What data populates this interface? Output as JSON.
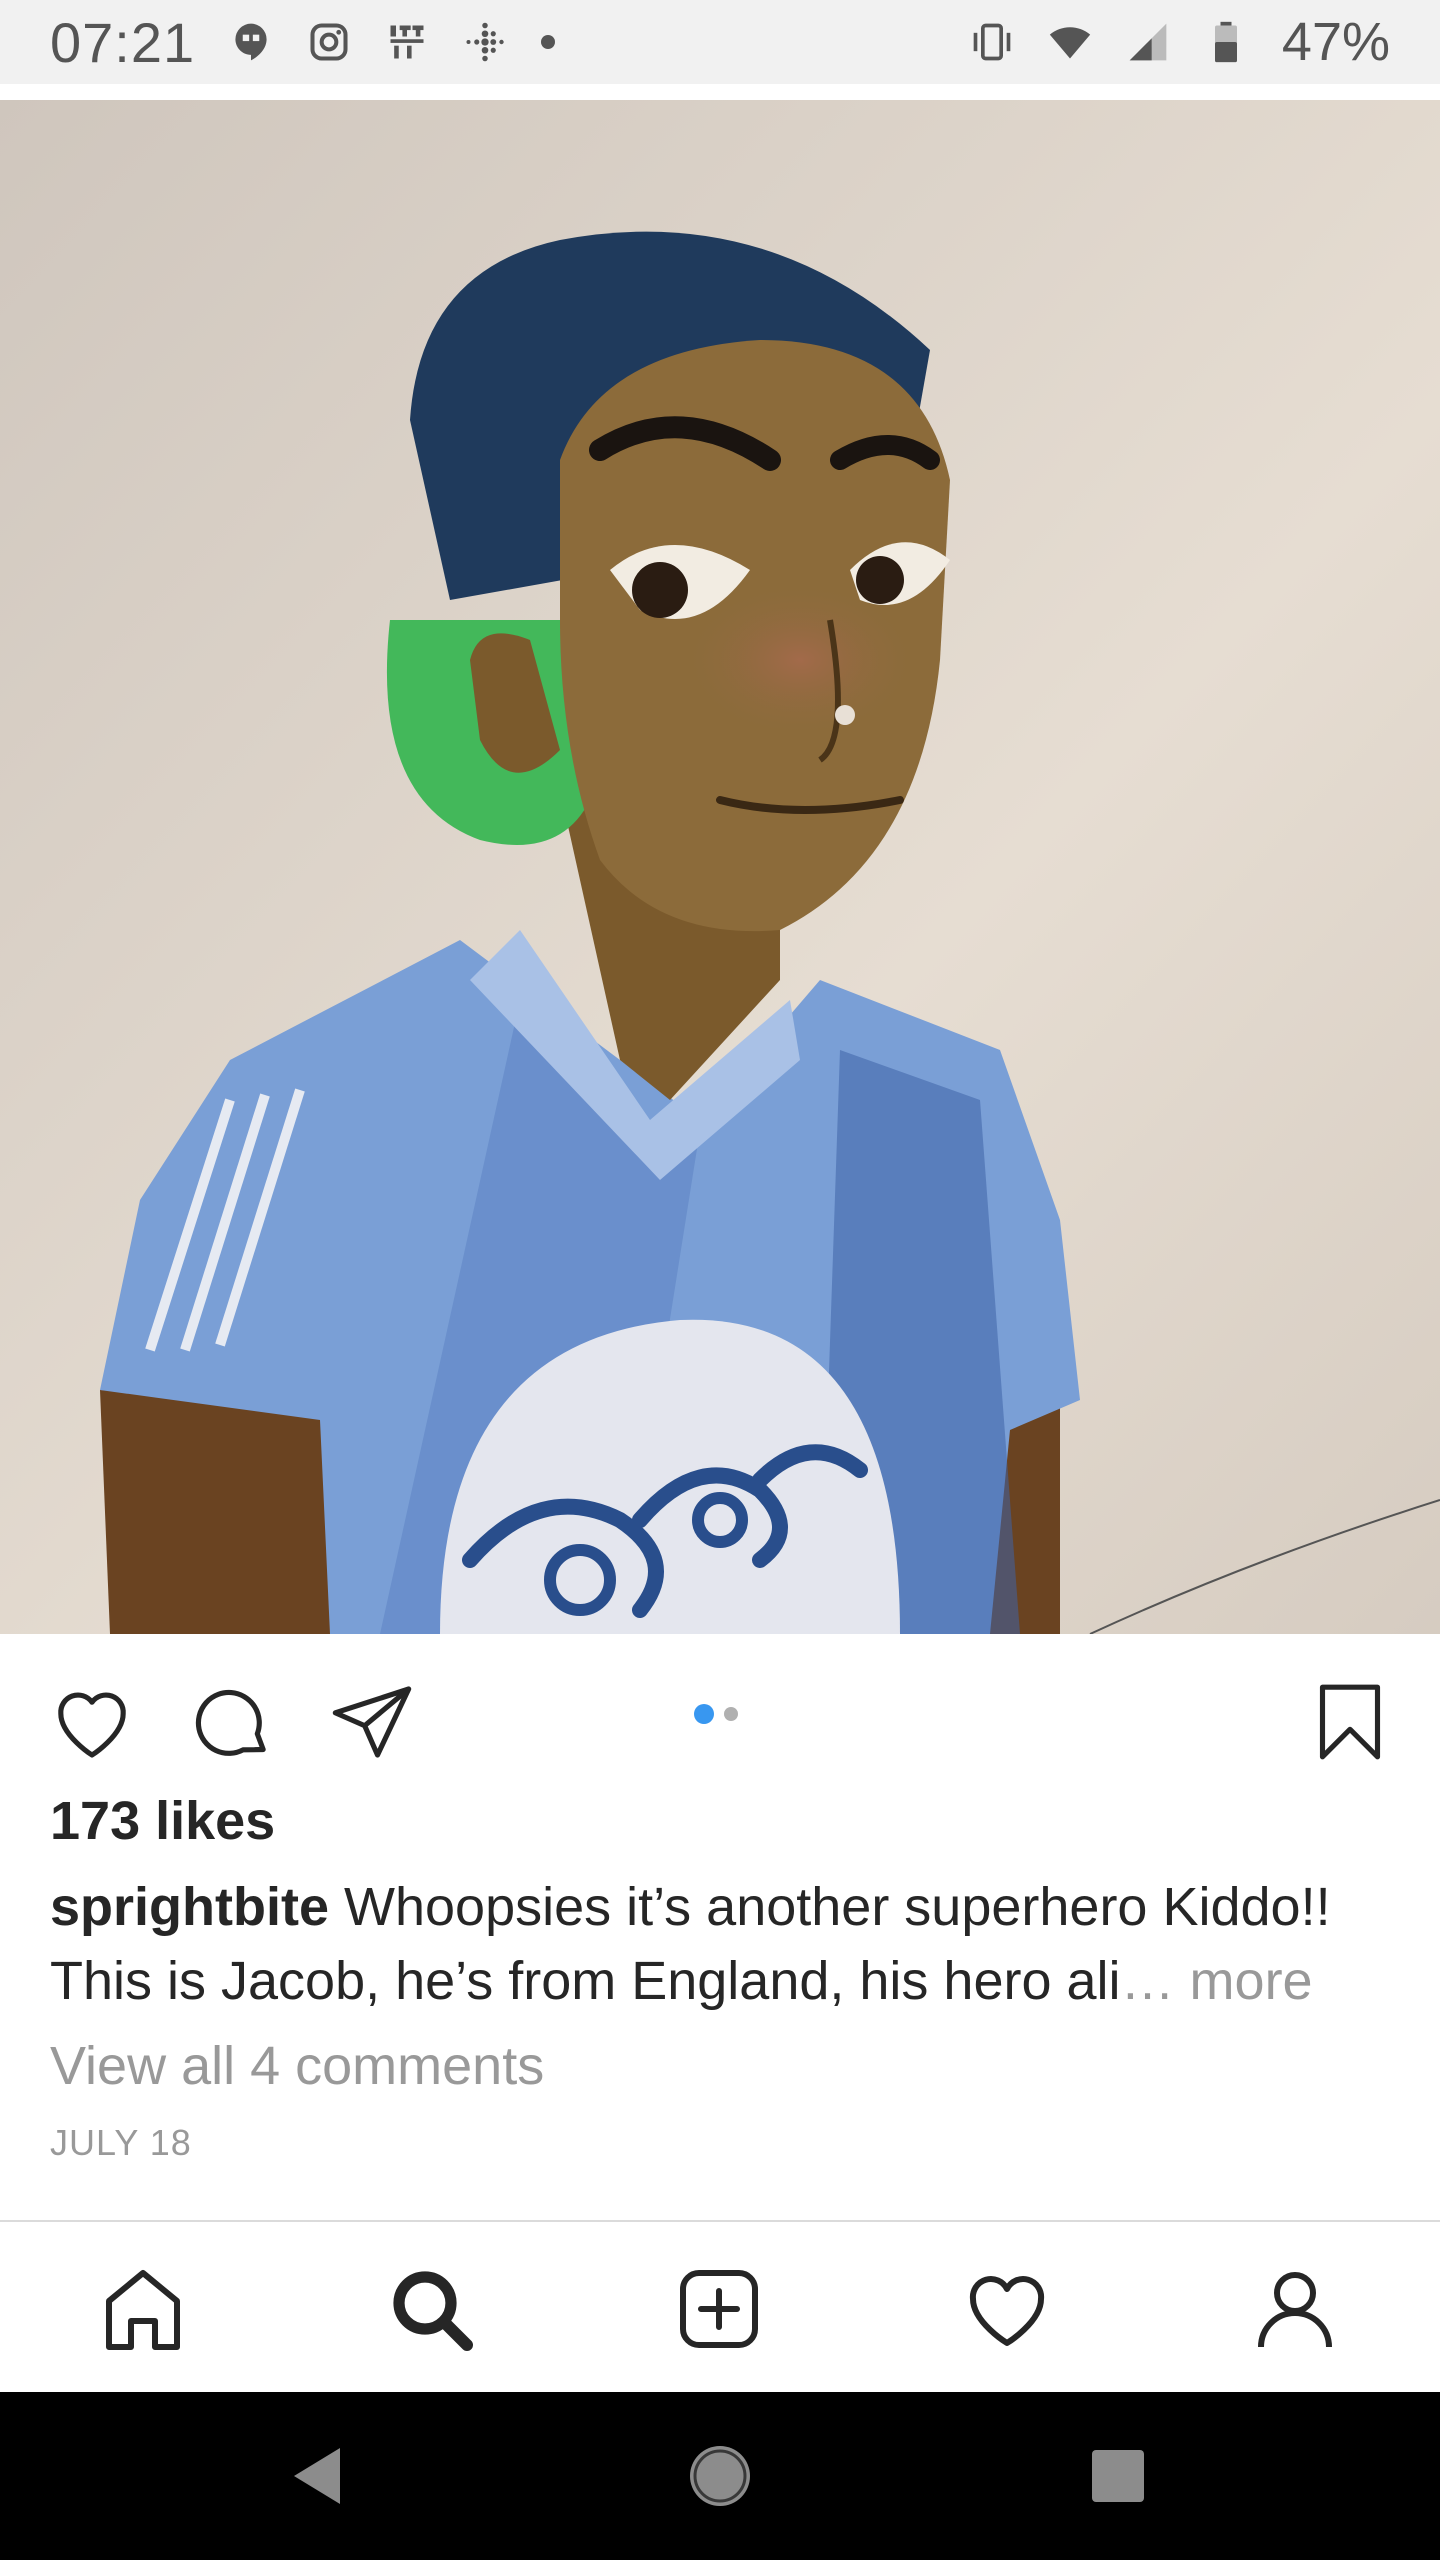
{
  "status_bar": {
    "time": "07:21",
    "battery": "47%",
    "left_icons": [
      "hangouts-icon",
      "instagram-icon",
      "ift-icon",
      "fitbit-icon",
      "dot-icon"
    ],
    "right_icons": [
      "vibrate-icon",
      "wifi-icon",
      "signal-icon",
      "battery-icon"
    ]
  },
  "post": {
    "image_alt": "Watercolor illustration",
    "likes_text": "173 likes",
    "username": "sprightbite",
    "caption_line1": " Whoopsies it’s another superhero Kiddo!!",
    "caption_line2": "This is Jacob, he’s from England, his hero ali",
    "more_text": "… more",
    "view_comments": "View all 4 comments",
    "date": "JULY 18",
    "carousel": {
      "count": 2,
      "active_index": 0
    }
  },
  "actions": {
    "like": "heart-outline-icon",
    "comment": "comment-bubble-icon",
    "share": "paper-plane-icon",
    "save": "bookmark-icon"
  },
  "bottom_nav": [
    "home-icon",
    "search-icon",
    "add-post-icon",
    "activity-heart-icon",
    "profile-icon"
  ],
  "system_nav": [
    "back-icon",
    "home-circle-icon",
    "recents-icon"
  ],
  "colors": {
    "accent": "#3897f0",
    "text": "#262626",
    "muted": "#999999",
    "status_bar_bg": "#f1f1f1"
  }
}
